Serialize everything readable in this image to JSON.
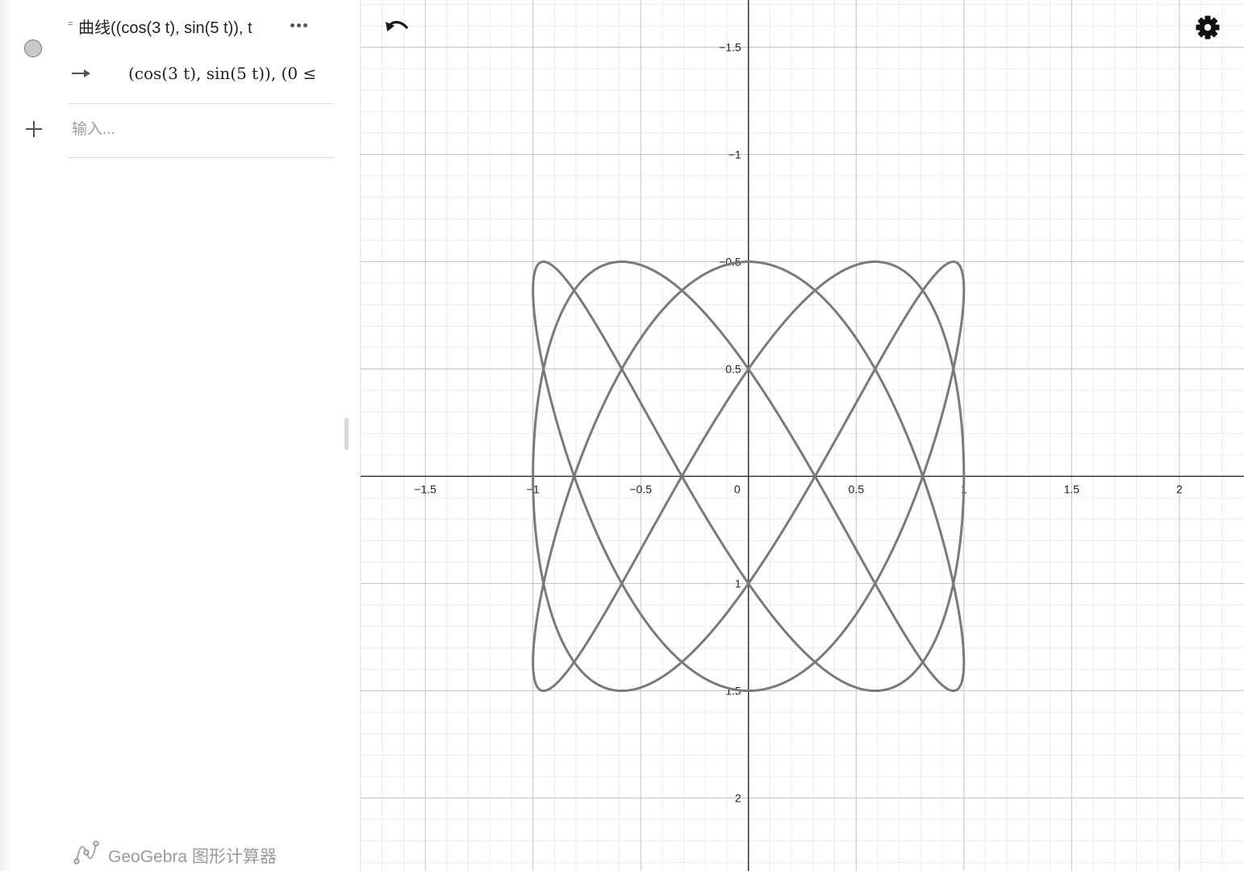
{
  "algebra_view": {
    "definition_prefix": "=",
    "definition": "曲线((cos(3 t), sin(5 t)), t",
    "value": "(cos(3 t), sin(5 t)),     (0 ≤",
    "input_placeholder": "输入..."
  },
  "branding": {
    "app_name": "GeoGebra 图形计算器"
  },
  "graphics_view": {
    "x_ticks": [
      "−1.5",
      "−1",
      "−0.5",
      "0",
      "0.5",
      "1",
      "1.5",
      "2"
    ],
    "y_ticks": [
      "2",
      "1.5",
      "1",
      "0.5",
      "−0.5",
      "−1",
      "−1.5"
    ],
    "x_range": [
      -1.8,
      2.3
    ],
    "y_range": [
      -1.84,
      2.22
    ]
  },
  "chart_data": {
    "type": "line",
    "series": [
      {
        "x_expression": "cos(3 t)",
        "y_expression": "sin(5 t)"
      }
    ],
    "xlim": [
      -1.8,
      2.3
    ],
    "ylim": [
      -1.84,
      2.22
    ],
    "x_ticks": [
      -1.5,
      -1,
      -0.5,
      0,
      0.5,
      1,
      1.5,
      2
    ],
    "y_ticks": [
      -1.5,
      -1,
      -0.5,
      0.5,
      1,
      1.5,
      2
    ],
    "grid": true,
    "curve_color": "#7a7a7a"
  },
  "colors": {
    "axis": "#252525",
    "major_grid": "#c4c4c4",
    "minor_grid": "#ececec",
    "curve": "#7a7a7a"
  }
}
